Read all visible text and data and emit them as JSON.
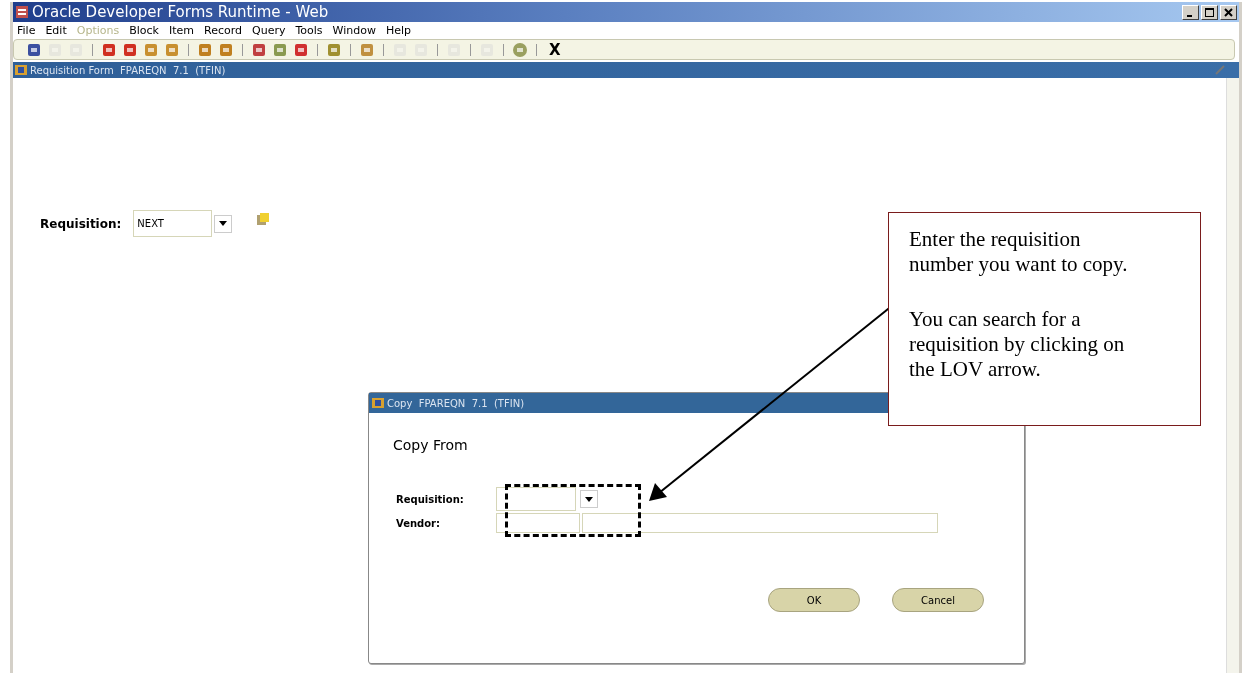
{
  "window": {
    "title": "Oracle Developer Forms Runtime - Web"
  },
  "menu": [
    {
      "label": "File",
      "disabled": false
    },
    {
      "label": "Edit",
      "disabled": false
    },
    {
      "label": "Options",
      "disabled": true
    },
    {
      "label": "Block",
      "disabled": false
    },
    {
      "label": "Item",
      "disabled": false
    },
    {
      "label": "Record",
      "disabled": false
    },
    {
      "label": "Query",
      "disabled": false
    },
    {
      "label": "Tools",
      "disabled": false
    },
    {
      "label": "Window",
      "disabled": false
    },
    {
      "label": "Help",
      "disabled": false
    }
  ],
  "toolbar": [
    {
      "kind": "save",
      "disabled": false
    },
    {
      "kind": "undo",
      "disabled": true
    },
    {
      "kind": "page",
      "disabled": true
    },
    {
      "kind": "separator"
    },
    {
      "kind": "prev-block",
      "disabled": false
    },
    {
      "kind": "prev-record",
      "disabled": false
    },
    {
      "kind": "up",
      "disabled": false
    },
    {
      "kind": "down",
      "disabled": false
    },
    {
      "kind": "separator"
    },
    {
      "kind": "insert",
      "disabled": false
    },
    {
      "kind": "remove",
      "disabled": false
    },
    {
      "kind": "separator"
    },
    {
      "kind": "query",
      "disabled": false
    },
    {
      "kind": "grid",
      "disabled": false
    },
    {
      "kind": "delete",
      "disabled": false
    },
    {
      "kind": "separator"
    },
    {
      "kind": "lookup",
      "disabled": false
    },
    {
      "kind": "separator"
    },
    {
      "kind": "print",
      "disabled": false
    },
    {
      "kind": "separator"
    },
    {
      "kind": "doc",
      "disabled": true
    },
    {
      "kind": "doc",
      "disabled": true
    },
    {
      "kind": "separator"
    },
    {
      "kind": "nav",
      "disabled": true
    },
    {
      "kind": "separator"
    },
    {
      "kind": "target",
      "disabled": true
    },
    {
      "kind": "separator"
    },
    {
      "kind": "help",
      "disabled": false
    },
    {
      "kind": "separator"
    },
    {
      "kind": "text",
      "text": "X"
    }
  ],
  "form": {
    "title": "Requisition Form  FPAREQN  7.1  (TFIN)",
    "label": "Requisition:",
    "value": "NEXT"
  },
  "dialog": {
    "title": "Copy  FPAREQN  7.1  (TFIN)",
    "heading": "Copy From",
    "requisition_label": "Requisition:",
    "vendor_label": "Vendor:",
    "buttons": [
      "OK",
      "Cancel"
    ]
  },
  "callout": {
    "paragraphs": [
      "Enter the requisition number you want to copy.",
      "You can search for a requisition by clicking on the LOV arrow."
    ]
  }
}
